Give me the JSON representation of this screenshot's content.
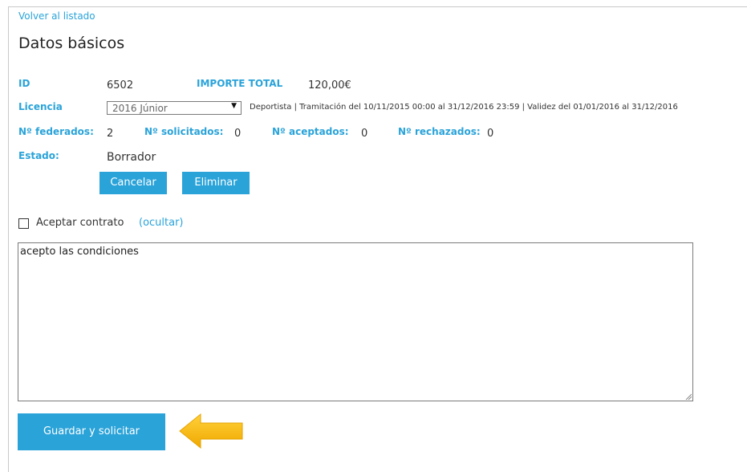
{
  "back_link": "Volver al listado",
  "page_title": "Datos básicos",
  "fields": {
    "id_label": "ID",
    "id_value": "6502",
    "total_label": "IMPORTE TOTAL",
    "total_value": "120,00€",
    "license_label": "Licencia",
    "license_selected": "2016 Júnior",
    "license_info": "Deportista | Tramitación del 10/11/2015 00:00 al 31/12/2016 23:59 | Validez del 01/01/2016 al 31/12/2016",
    "federados_label": "Nº federados:",
    "federados_value": "2",
    "solicitados_label": "Nº solicitados:",
    "solicitados_value": "0",
    "aceptados_label": "Nº aceptados:",
    "aceptados_value": "0",
    "rechazados_label": "Nº rechazados:",
    "rechazados_value": "0",
    "estado_label": "Estado:",
    "estado_value": "Borrador"
  },
  "buttons": {
    "cancel": "Cancelar",
    "delete": "Eliminar",
    "save": "Guardar y solicitar"
  },
  "contract": {
    "checkbox_label": "Aceptar contrato",
    "toggle_link": "(ocultar)",
    "text": "acepto las condiciones",
    "checked": false
  },
  "colors": {
    "accent": "#2aa3d9",
    "arrow": "#f5b800"
  },
  "icons": {
    "select_caret": "▼",
    "highlight_arrow": "arrow-left-icon"
  }
}
